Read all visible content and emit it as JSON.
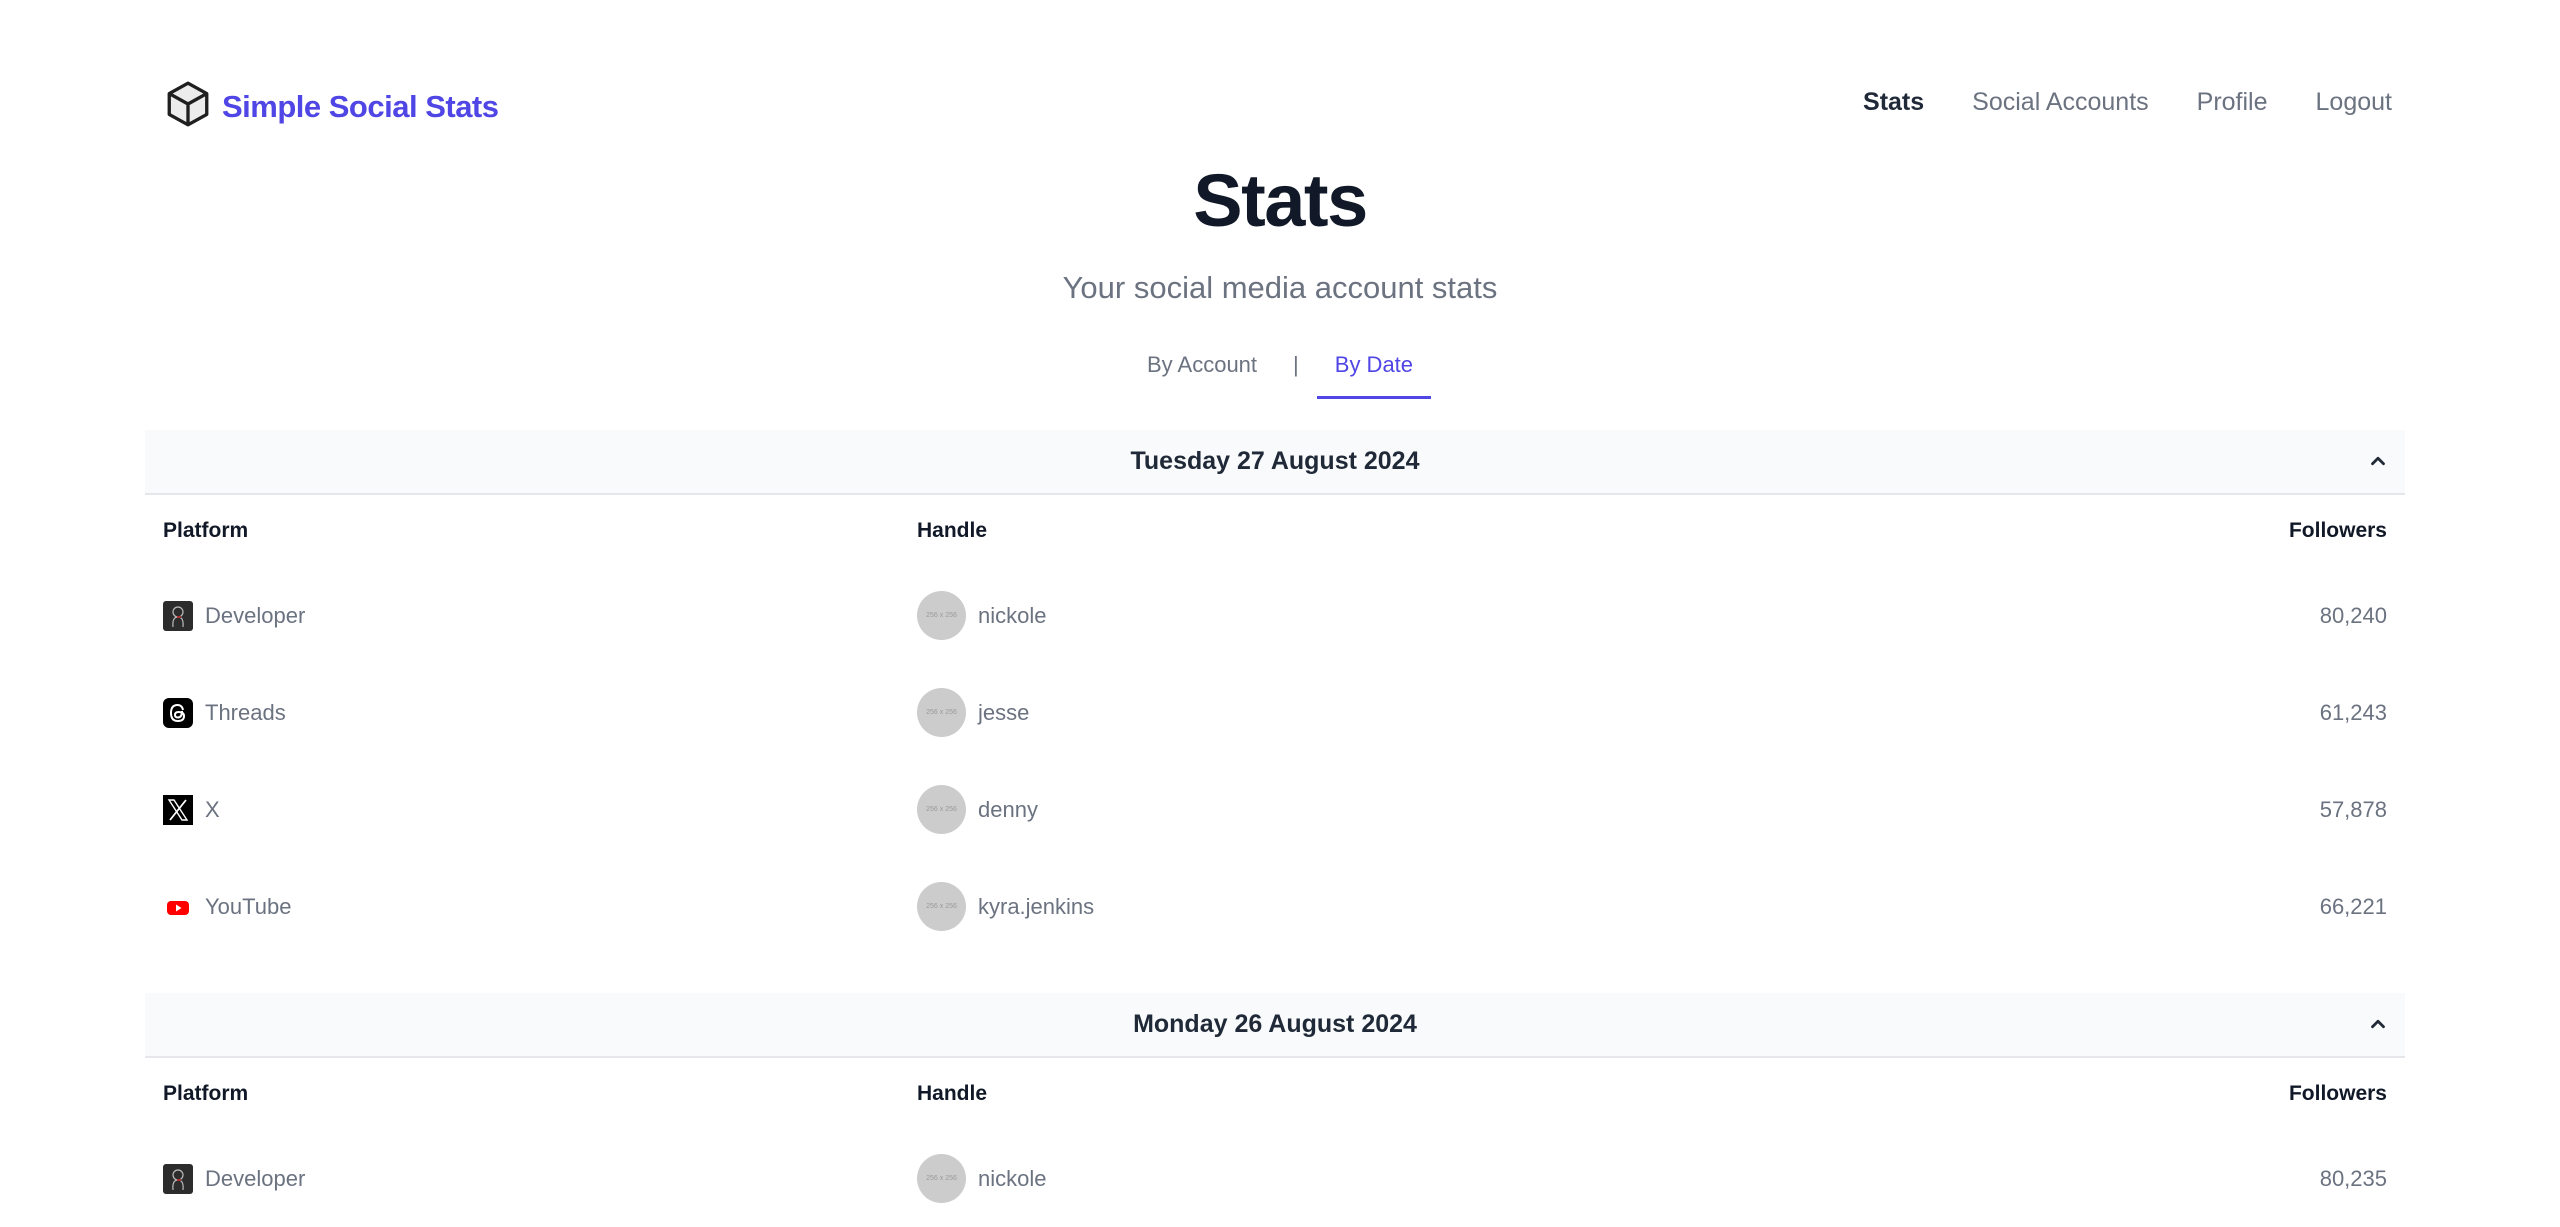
{
  "app": {
    "name": "Simple Social Stats",
    "brand_color": "#4f46e5"
  },
  "nav": {
    "items": [
      {
        "label": "Stats",
        "active": true
      },
      {
        "label": "Social Accounts",
        "active": false
      },
      {
        "label": "Profile",
        "active": false
      },
      {
        "label": "Logout",
        "active": false
      }
    ]
  },
  "page": {
    "title": "Stats",
    "subtitle": "Your social media account stats"
  },
  "tabs": {
    "items": [
      {
        "label": "By Account",
        "active": false
      },
      {
        "label": "By Date",
        "active": true
      }
    ],
    "separator": "|"
  },
  "columns": {
    "platform": "Platform",
    "handle": "Handle",
    "followers": "Followers"
  },
  "avatar_placeholder": "256 x 256",
  "sections": [
    {
      "date": "Tuesday 27 August 2024",
      "expanded": true,
      "rows": [
        {
          "platform": "Developer",
          "icon": "developer-icon",
          "handle": "nickole",
          "followers": "80,240"
        },
        {
          "platform": "Threads",
          "icon": "threads-icon",
          "handle": "jesse",
          "followers": "61,243"
        },
        {
          "platform": "X",
          "icon": "x-icon",
          "handle": "denny",
          "followers": "57,878"
        },
        {
          "platform": "YouTube",
          "icon": "youtube-icon",
          "handle": "kyra.jenkins",
          "followers": "66,221"
        }
      ]
    },
    {
      "date": "Monday 26 August 2024",
      "expanded": true,
      "rows": [
        {
          "platform": "Developer",
          "icon": "developer-icon",
          "handle": "nickole",
          "followers": "80,235"
        }
      ]
    }
  ]
}
